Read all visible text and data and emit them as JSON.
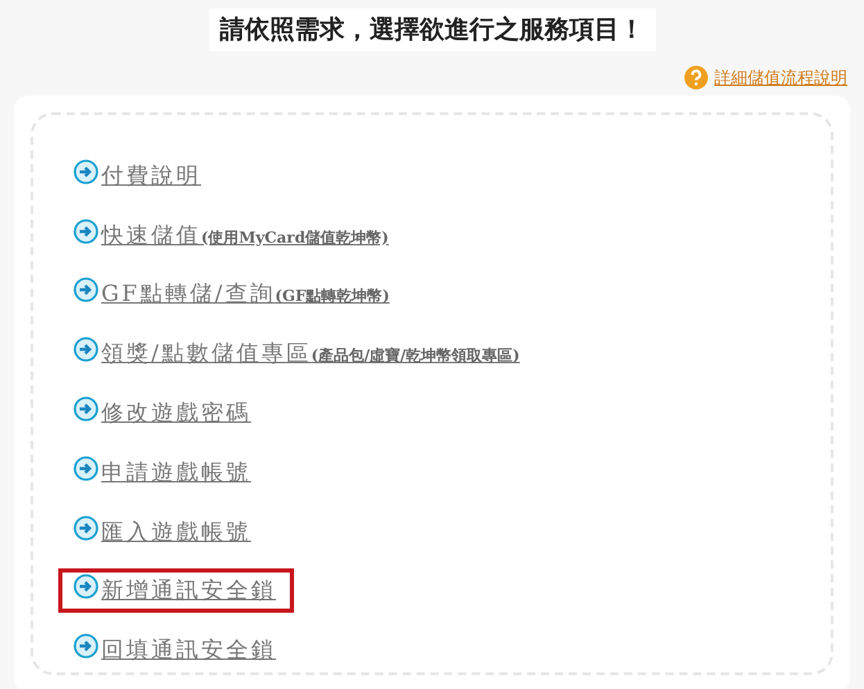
{
  "heading": "請依照需求，選擇欲進行之服務項目！",
  "help_link": {
    "label": "詳細儲值流程說明"
  },
  "services": [
    {
      "label": "付費說明",
      "highlighted": false
    },
    {
      "label": "快速儲值",
      "note": "(使用MyCard儲值乾坤幣)",
      "highlighted": false
    },
    {
      "label": "GF點轉儲/查詢",
      "note": "(GF點轉乾坤幣)",
      "highlighted": false
    },
    {
      "label": "領獎/點數儲值專區",
      "note": "(產品包/虛寶/乾坤幣領取專區)",
      "highlighted": false
    },
    {
      "label": "修改遊戲密碼",
      "highlighted": false
    },
    {
      "label": "申請遊戲帳號",
      "highlighted": false
    },
    {
      "label": "匯入遊戲帳號",
      "highlighted": false
    },
    {
      "label": "新增通訊安全鎖",
      "highlighted": true
    },
    {
      "label": "回填通訊安全鎖",
      "highlighted": false
    }
  ]
}
